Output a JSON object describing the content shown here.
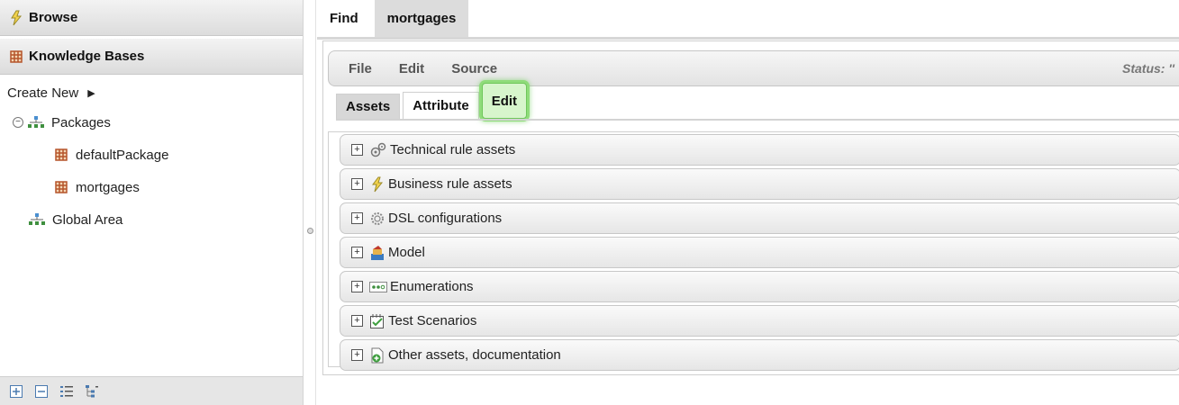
{
  "left": {
    "browse_title": "Browse",
    "kb_title": "Knowledge Bases",
    "create_new": "Create New",
    "tree": {
      "packages_label": "Packages",
      "packages": [
        "defaultPackage",
        "mortgages"
      ],
      "global_area": "Global Area"
    },
    "footer_icons": [
      "expand-all-icon",
      "collapse-all-icon",
      "flat-view-icon",
      "hierarchical-view-icon"
    ]
  },
  "top_tabs": [
    "Find",
    "mortgages"
  ],
  "editor": {
    "menu": [
      "File",
      "Edit",
      "Source"
    ],
    "status": "Status: ''",
    "subtabs": [
      "Assets",
      "Attribute",
      "Edit"
    ],
    "asset_groups": [
      {
        "label": "Technical rule assets",
        "icon": "gears-icon"
      },
      {
        "label": "Business rule assets",
        "icon": "business-rule-icon"
      },
      {
        "label": "DSL configurations",
        "icon": "dsl-gear-icon"
      },
      {
        "label": "Model",
        "icon": "model-icon"
      },
      {
        "label": "Enumerations",
        "icon": "enumeration-icon"
      },
      {
        "label": "Test Scenarios",
        "icon": "test-scenario-icon"
      },
      {
        "label": "Other assets, documentation",
        "icon": "other-assets-icon"
      }
    ]
  },
  "colors": {
    "highlight": "#8fdc7a",
    "package_icon": "#b5542a",
    "tree_icon": "#3f8f3f"
  }
}
